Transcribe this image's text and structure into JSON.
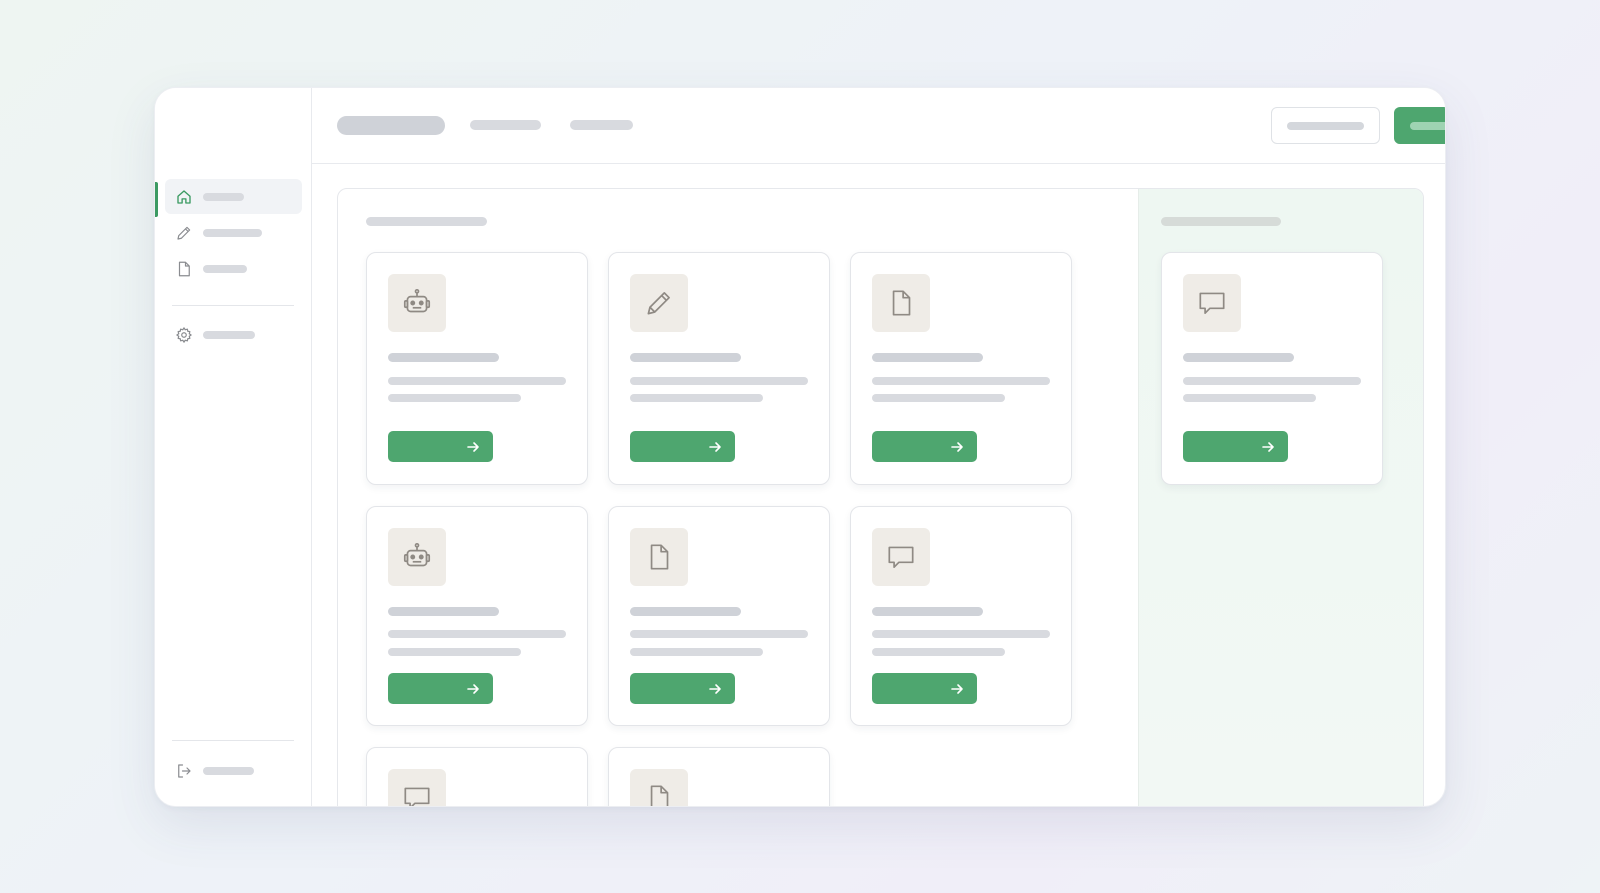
{
  "colors": {
    "accent": "#4ea66f",
    "accent_indicator": "#3b9a62",
    "placeholder_bar": "#d8dadf",
    "icon_tile": "#efece7",
    "right_panel_bg": "#eef7f2"
  },
  "sidebar": {
    "items": [
      {
        "icon": "home-icon",
        "active": true
      },
      {
        "icon": "pencil-icon",
        "active": false
      },
      {
        "icon": "file-icon",
        "active": false
      },
      {
        "icon": "gear-icon",
        "active": false
      }
    ],
    "footer": {
      "icon": "logout-icon"
    }
  },
  "header": {
    "tabs": 2,
    "secondary_button": "outline-button",
    "primary_button": "primary-button",
    "avatar": "user-avatar"
  },
  "main": {
    "cards": [
      {
        "icon": "robot-icon",
        "action_icon": "arrow-right-icon"
      },
      {
        "icon": "pencil-icon",
        "action_icon": "arrow-right-icon"
      },
      {
        "icon": "file-icon",
        "action_icon": "arrow-right-icon"
      },
      {
        "icon": "robot-icon",
        "action_icon": "arrow-right-icon"
      },
      {
        "icon": "file-icon",
        "action_icon": "arrow-right-icon"
      },
      {
        "icon": "chat-icon",
        "action_icon": "arrow-right-icon"
      },
      {
        "icon": "chat-icon",
        "action_icon": "arrow-right-icon"
      },
      {
        "icon": "file-icon",
        "action_icon": "arrow-right-icon"
      }
    ]
  },
  "right_panel": {
    "cards": [
      {
        "icon": "chat-icon",
        "action_icon": "arrow-right-icon"
      }
    ]
  }
}
